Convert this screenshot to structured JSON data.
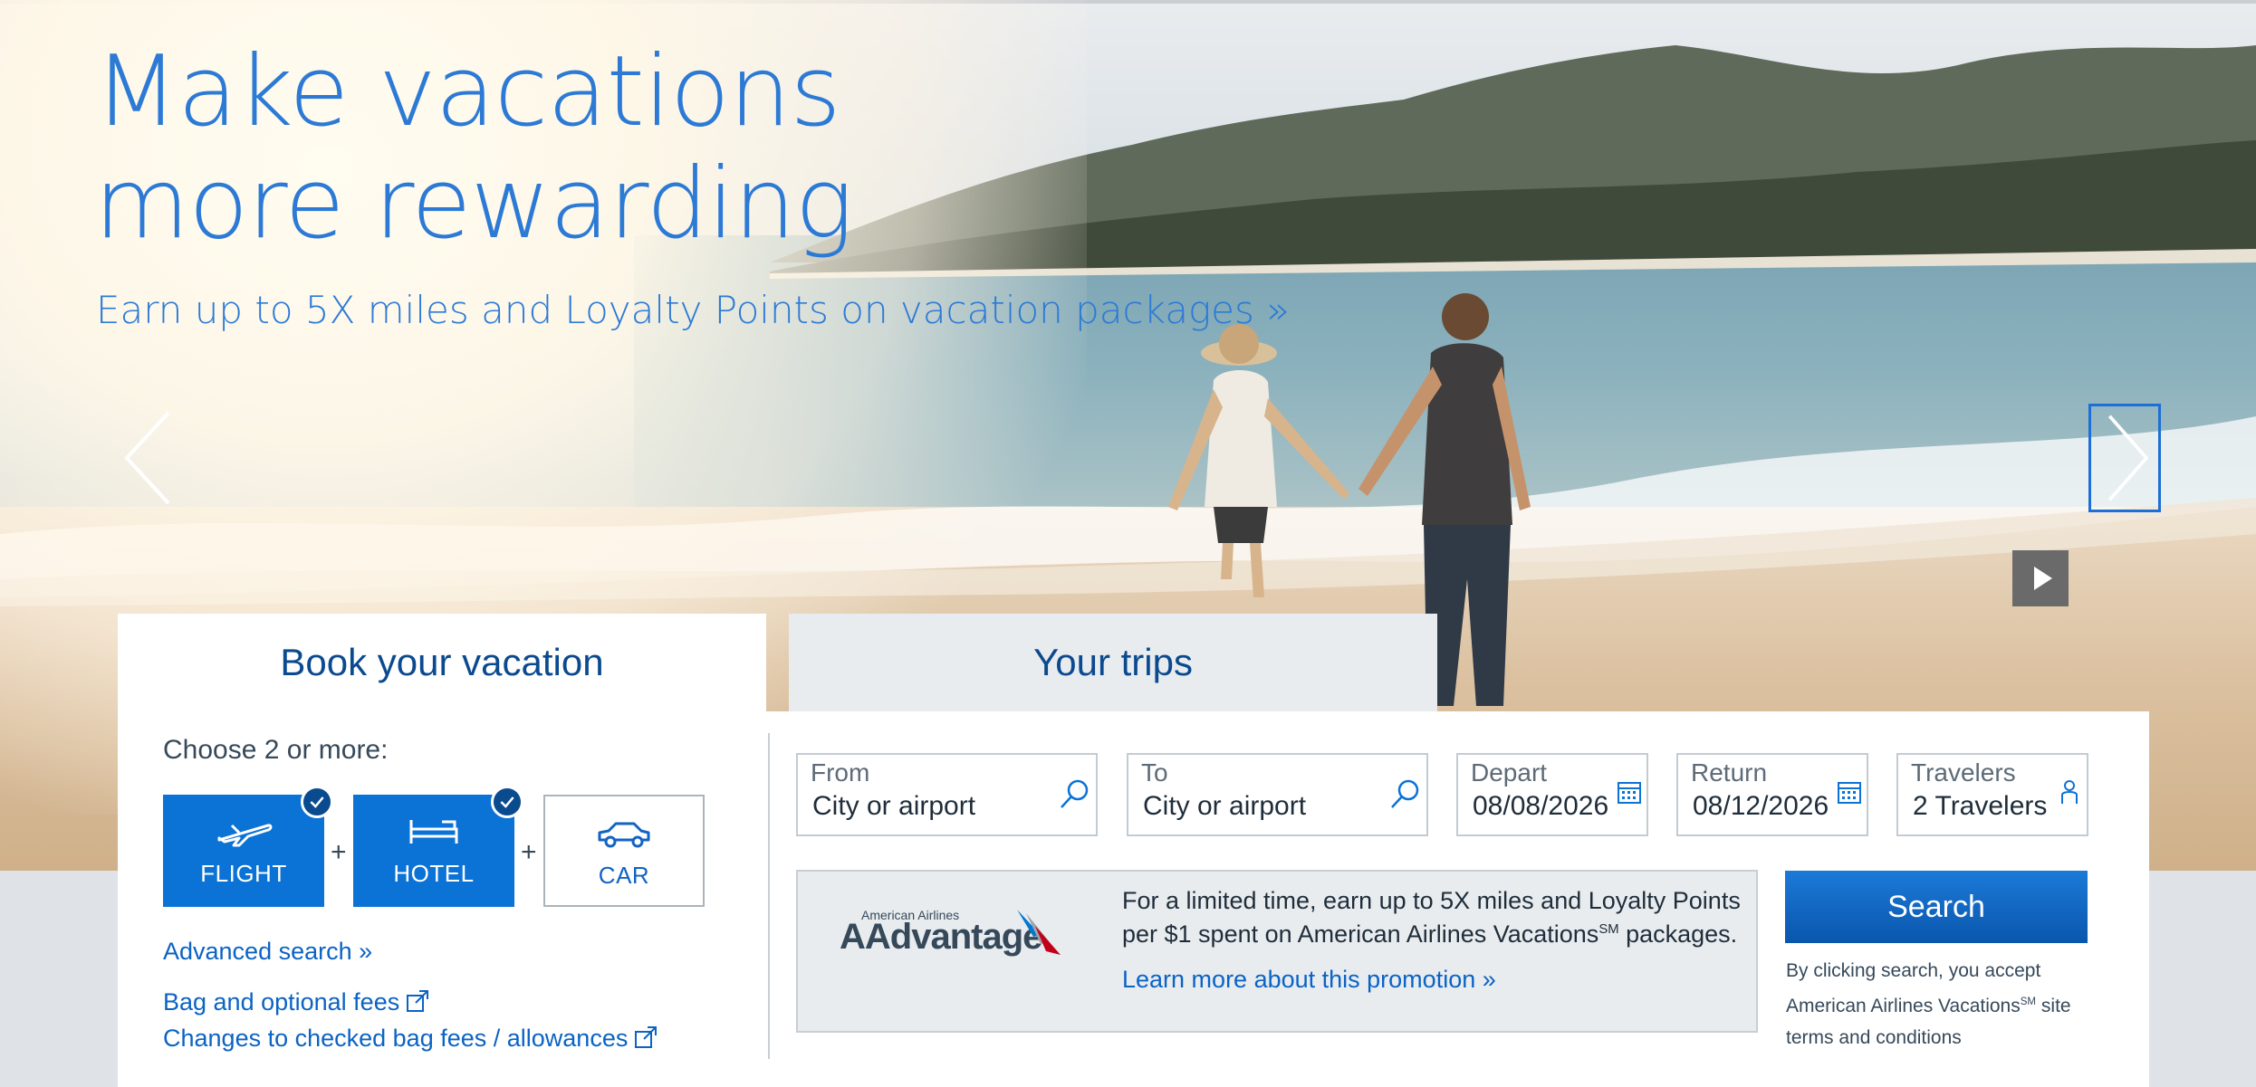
{
  "hero": {
    "title_line1": "Make vacations",
    "title_line2": "more rewarding",
    "subtitle": "Earn up to 5X miles and Loyalty Points on vacation packages  »"
  },
  "carousel": {
    "prev_icon": "chevron-left-icon",
    "next_icon": "chevron-right-icon",
    "play_icon": "play-icon"
  },
  "tabs": {
    "book": "Book your vacation",
    "trips": "Your trips"
  },
  "products": {
    "choose_label": "Choose 2 or more:",
    "items": [
      {
        "label": "FLIGHT",
        "icon": "plane-icon",
        "selected": true
      },
      {
        "label": "HOTEL",
        "icon": "bed-icon",
        "selected": true
      },
      {
        "label": "CAR",
        "icon": "car-icon",
        "selected": false
      }
    ],
    "plus": "+"
  },
  "links": {
    "advanced_search": "Advanced search  »",
    "bag_fees": "Bag and optional fees",
    "checked_bag_changes": "Changes to checked bag fees / allowances"
  },
  "fields": {
    "from": {
      "label": "From",
      "value": "City or airport"
    },
    "to": {
      "label": "To",
      "value": "City or airport"
    },
    "depart": {
      "label": "Depart",
      "value": "08/08/2026"
    },
    "return": {
      "label": "Return",
      "value": "08/12/2026"
    },
    "travelers": {
      "label": "Travelers",
      "value": "2 Travelers"
    }
  },
  "promo": {
    "logo_small": "American Airlines",
    "logo_big": "AAdvantage",
    "text_line1": "For a limited time, earn up to 5X miles and Loyalty Points",
    "text_line2_a": "per $1 spent on American Airlines Vacations",
    "text_line2_sup": "SM",
    "text_line2_b": " packages.",
    "link": "Learn more about this promotion »"
  },
  "search": {
    "button": "Search",
    "disclaimer_a": "By clicking search, you accept American Airlines Vacations",
    "disclaimer_sup": "SM",
    "disclaimer_b": " site terms and conditions"
  },
  "colors": {
    "brand_blue": "#0b72d6",
    "heading_blue": "#2c7ad6",
    "tab_text": "#0b4a8f"
  }
}
